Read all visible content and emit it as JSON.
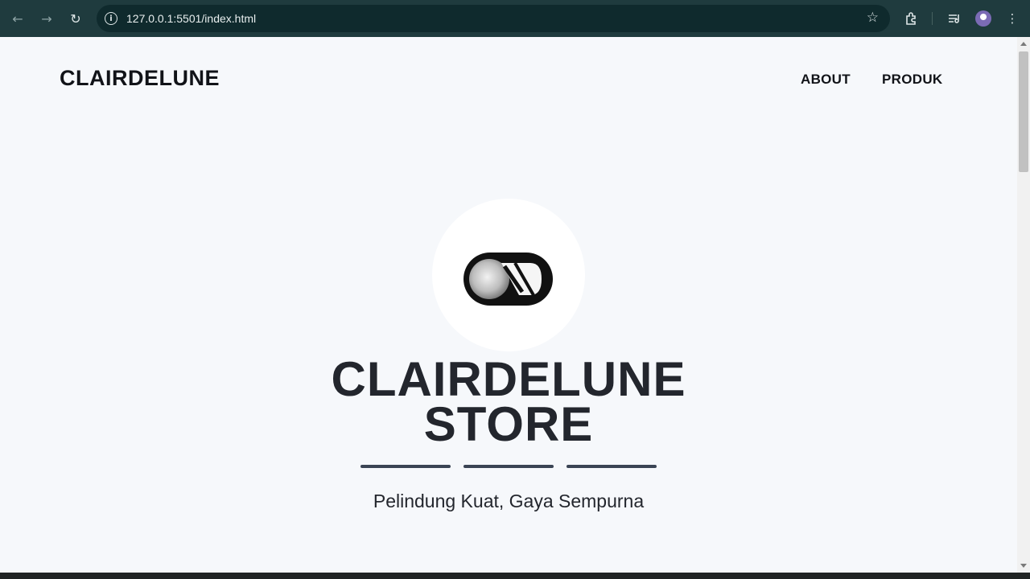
{
  "browser": {
    "url": "127.0.0.1:5501/index.html",
    "icons": [
      "back-icon",
      "forward-icon",
      "reload-icon",
      "info-icon",
      "star-icon",
      "extensions-icon",
      "reading-list-icon",
      "profile-avatar",
      "menu-icon"
    ]
  },
  "site": {
    "brand": "CLAIRDELUNE",
    "nav": [
      {
        "label": "ABOUT"
      },
      {
        "label": "PRODUK"
      }
    ]
  },
  "hero": {
    "title_line1": "CLAIRDELUNE",
    "title_line2": "STORE",
    "tagline": "Pelindung Kuat, Gaya Sempurna"
  },
  "colors": {
    "page_background": "#f6f8fb",
    "text": "#23262d",
    "divider": "#3a4454",
    "chrome": "#1f3b3e"
  }
}
